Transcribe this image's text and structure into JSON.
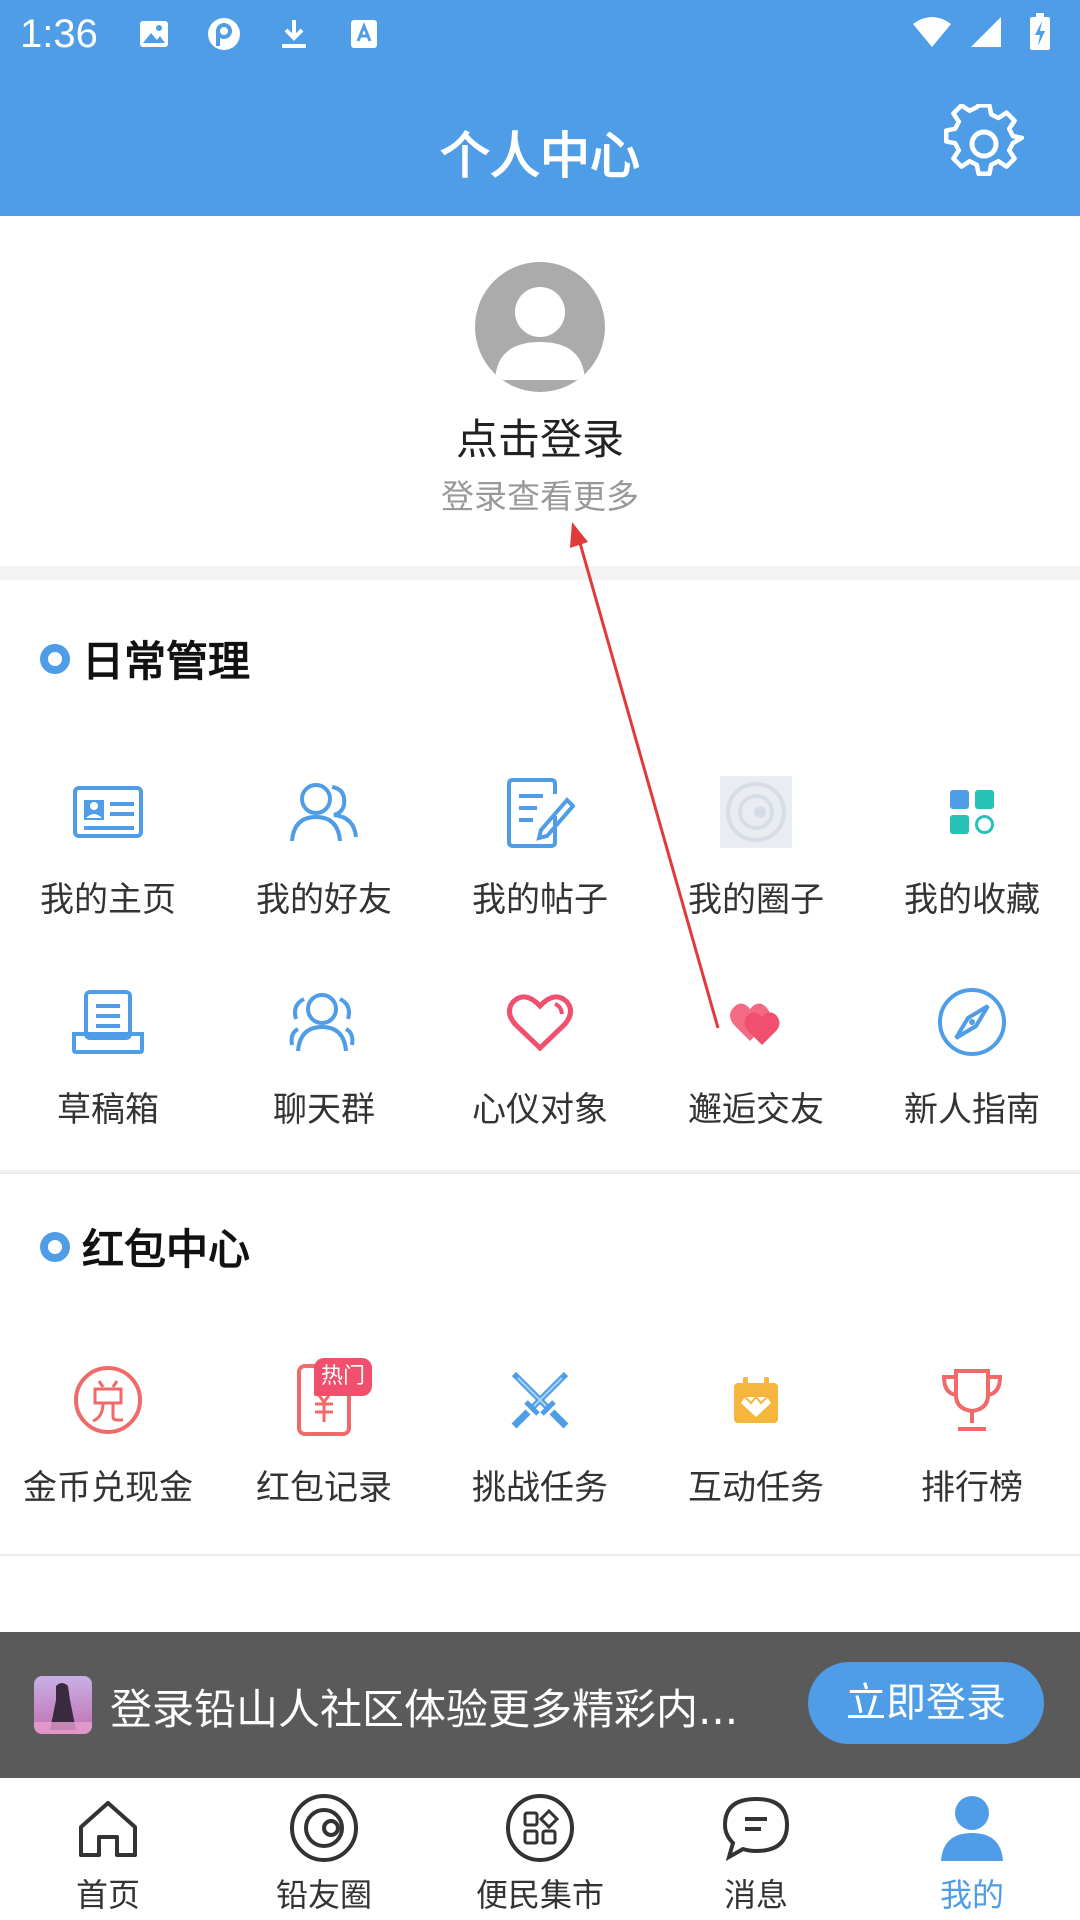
{
  "status_bar": {
    "time": "1:36"
  },
  "header": {
    "title": "个人中心"
  },
  "profile": {
    "login_label": "点击登录",
    "login_hint": "登录查看更多"
  },
  "daily": {
    "title": "日常管理",
    "items": [
      {
        "label": "我的主页",
        "icon": "id-card-icon"
      },
      {
        "label": "我的好友",
        "icon": "friends-icon"
      },
      {
        "label": "我的帖子",
        "icon": "post-edit-icon"
      },
      {
        "label": "我的圈子",
        "icon": "circle-icon"
      },
      {
        "label": "我的收藏",
        "icon": "favorites-grid-icon"
      },
      {
        "label": "草稿箱",
        "icon": "drafts-icon"
      },
      {
        "label": "聊天群",
        "icon": "chat-group-icon"
      },
      {
        "label": "心仪对象",
        "icon": "heart-outline-icon"
      },
      {
        "label": "邂逅交友",
        "icon": "hearts-icon"
      },
      {
        "label": "新人指南",
        "icon": "compass-icon"
      }
    ]
  },
  "redpacket": {
    "title": "红包中心",
    "hot_badge": "热门",
    "items": [
      {
        "label": "金币兑现金",
        "icon": "exchange-icon"
      },
      {
        "label": "红包记录",
        "icon": "red-packet-icon"
      },
      {
        "label": "挑战任务",
        "icon": "swords-icon"
      },
      {
        "label": "互动任务",
        "icon": "calendar-task-icon"
      },
      {
        "label": "排行榜",
        "icon": "trophy-icon"
      }
    ]
  },
  "banner": {
    "text": "登录铅山人社区体验更多精彩内...",
    "button": "立即登录"
  },
  "tabs": [
    {
      "label": "首页",
      "icon": "home-icon"
    },
    {
      "label": "铅友圈",
      "icon": "planet-icon"
    },
    {
      "label": "便民集市",
      "icon": "market-icon"
    },
    {
      "label": "消息",
      "icon": "message-icon"
    },
    {
      "label": "我的",
      "icon": "profile-icon"
    }
  ],
  "colors": {
    "primary": "#4e9de6",
    "accent_red": "#f0506e",
    "annotation_arrow": "#e03a3a"
  }
}
